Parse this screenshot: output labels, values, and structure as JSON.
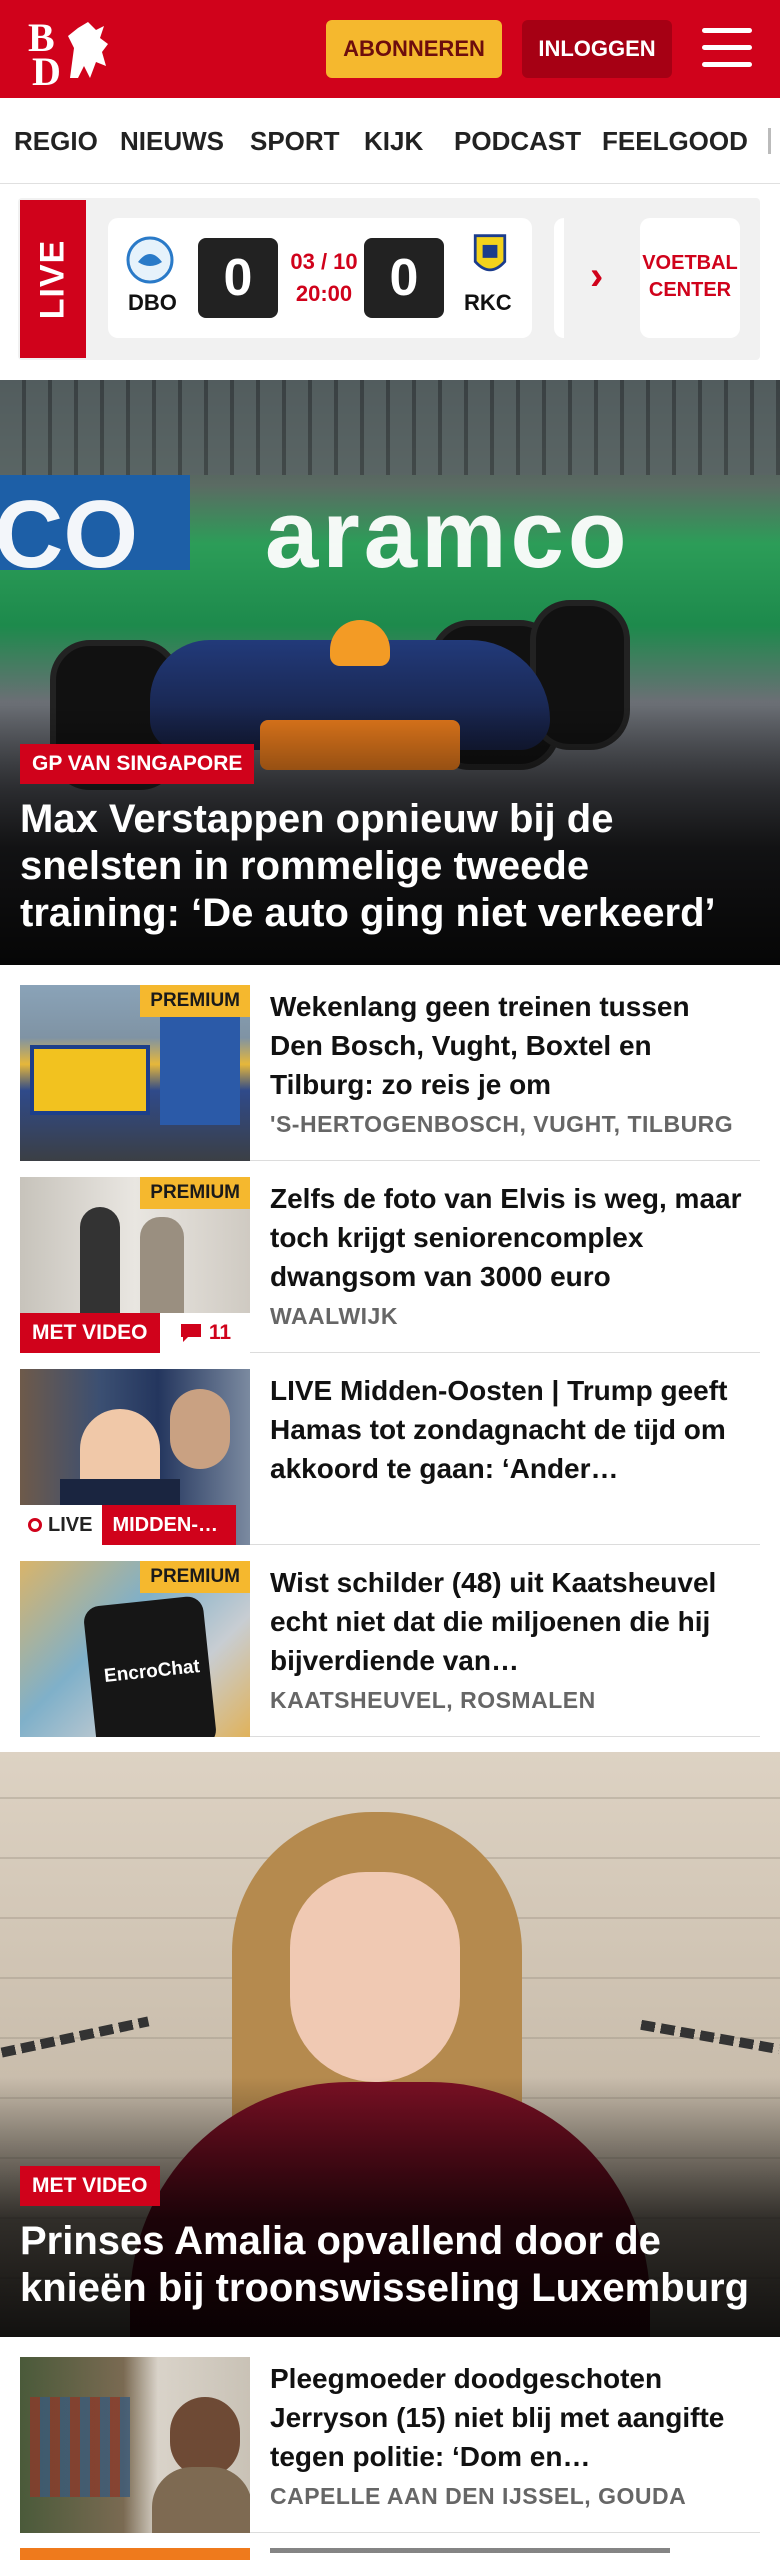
{
  "header": {
    "logo_top": "B",
    "logo_bottom": "D",
    "subscribe_label": "ABONNEREN",
    "login_label": "INLOGGEN"
  },
  "nav": {
    "items": [
      "REGIO",
      "NIEUWS",
      "SPORT",
      "KIJK",
      "PODCAST",
      "FEELGOOD"
    ]
  },
  "live": {
    "label": "LIVE",
    "home_team": "DBO",
    "away_team": "RKC",
    "home_score": "0",
    "away_score": "0",
    "date": "03 / 10",
    "time": "20:00",
    "center_label_line1": "VOETBAL",
    "center_label_line2": "CENTER"
  },
  "hero1": {
    "tag": "GP VAN SINGAPORE",
    "title": "Max Verstappen opnieuw bij de snelsten in rommelige tweede training: ‘De auto ging niet verkeerd’",
    "sponsor_text": "aramco",
    "sponsor_left": "CO"
  },
  "articles": [
    {
      "title": "Wekenlang geen treinen tussen Den Bosch, Vught, Boxtel en Tilburg: zo reis je om",
      "location": "'S-HERTOGENBOSCH, VUGHT, TILBURG",
      "premium": "PREMIUM"
    },
    {
      "title": "Zelfs de foto van Elvis is weg, maar toch krijgt seniorencom­plex dwangsom van 3000 euro",
      "location": "WAALWIJK",
      "premium": "PREMIUM",
      "video": "MET VIDEO",
      "comments": "11"
    },
    {
      "title": "LIVE Midden-Oosten | Trump geeft Hamas tot zondagnacht de tijd om akkoord te gaan: ‘Ander…",
      "live": "LIVE",
      "category": "MIDDEN-…"
    },
    {
      "title": "Wist schilder (48) uit Kaatsheu­vel echt niet dat die miljoenen die hij bijverdiende van…",
      "location": "KAATSHEUVEL, ROSMALEN",
      "premium": "PREMIUM",
      "phone_text": "EncroChat"
    },
    {
      "title": "Pleegmoeder doodgeschoten Jerryson (15) niet blij met aangifte tegen politie: ‘Dom en…",
      "location": "CAPELLE AAN DEN IJSSEL, GOUDA"
    }
  ],
  "hero2": {
    "tag": "MET VIDEO",
    "title": "Prinses Amalia opvallend door de knieën bij troonswisseling Luxemburg"
  },
  "colors": {
    "brand_red": "#d0021b",
    "subscribe_yellow": "#f5b82e",
    "login_dark_red": "#a60014"
  }
}
